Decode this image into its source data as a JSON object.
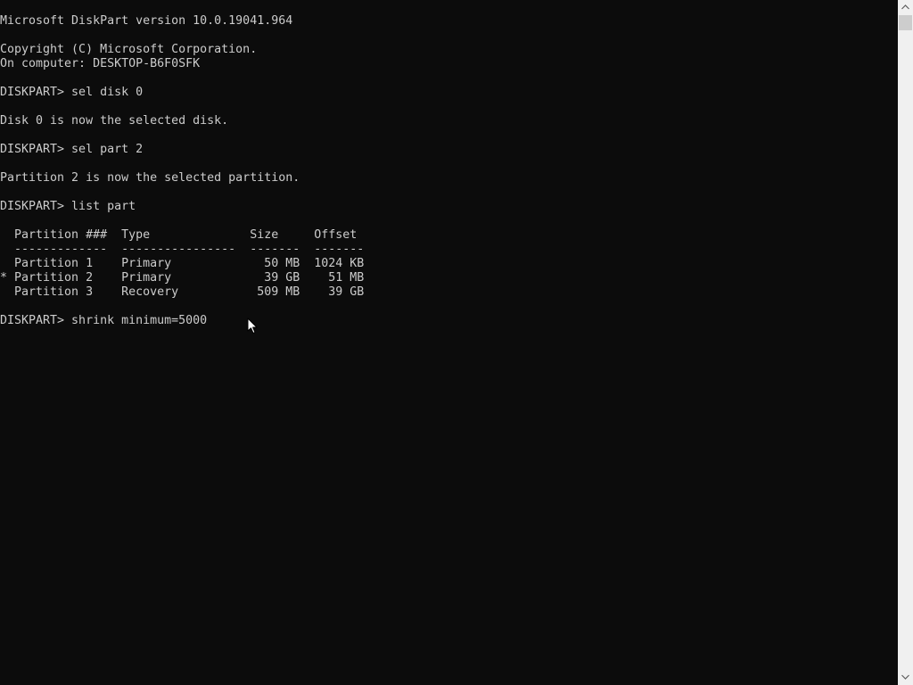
{
  "console": {
    "lines": [
      "Microsoft DiskPart version 10.0.19041.964",
      "",
      "Copyright (C) Microsoft Corporation.",
      "On computer: DESKTOP-B6F0SFK",
      "",
      "DISKPART> sel disk 0",
      "",
      "Disk 0 is now the selected disk.",
      "",
      "DISKPART> sel part 2",
      "",
      "Partition 2 is now the selected partition.",
      "",
      "DISKPART> list part",
      "",
      "  Partition ###  Type              Size     Offset",
      "  -------------  ----------------  -------  -------",
      "  Partition 1    Primary             50 MB  1024 KB",
      "* Partition 2    Primary             39 GB    51 MB",
      "  Partition 3    Recovery           509 MB    39 GB",
      "",
      "DISKPART> shrink minimum=5000"
    ]
  },
  "colors": {
    "background": "#0c0c0c",
    "foreground": "#cccccc",
    "scrollbar_track": "#f0f0f0",
    "scrollbar_thumb": "#cdcdcd"
  },
  "icons": {
    "scroll_up": "scroll-up-arrow-icon",
    "scroll_down": "scroll-down-arrow-icon",
    "pointer": "mouse-pointer-icon"
  }
}
